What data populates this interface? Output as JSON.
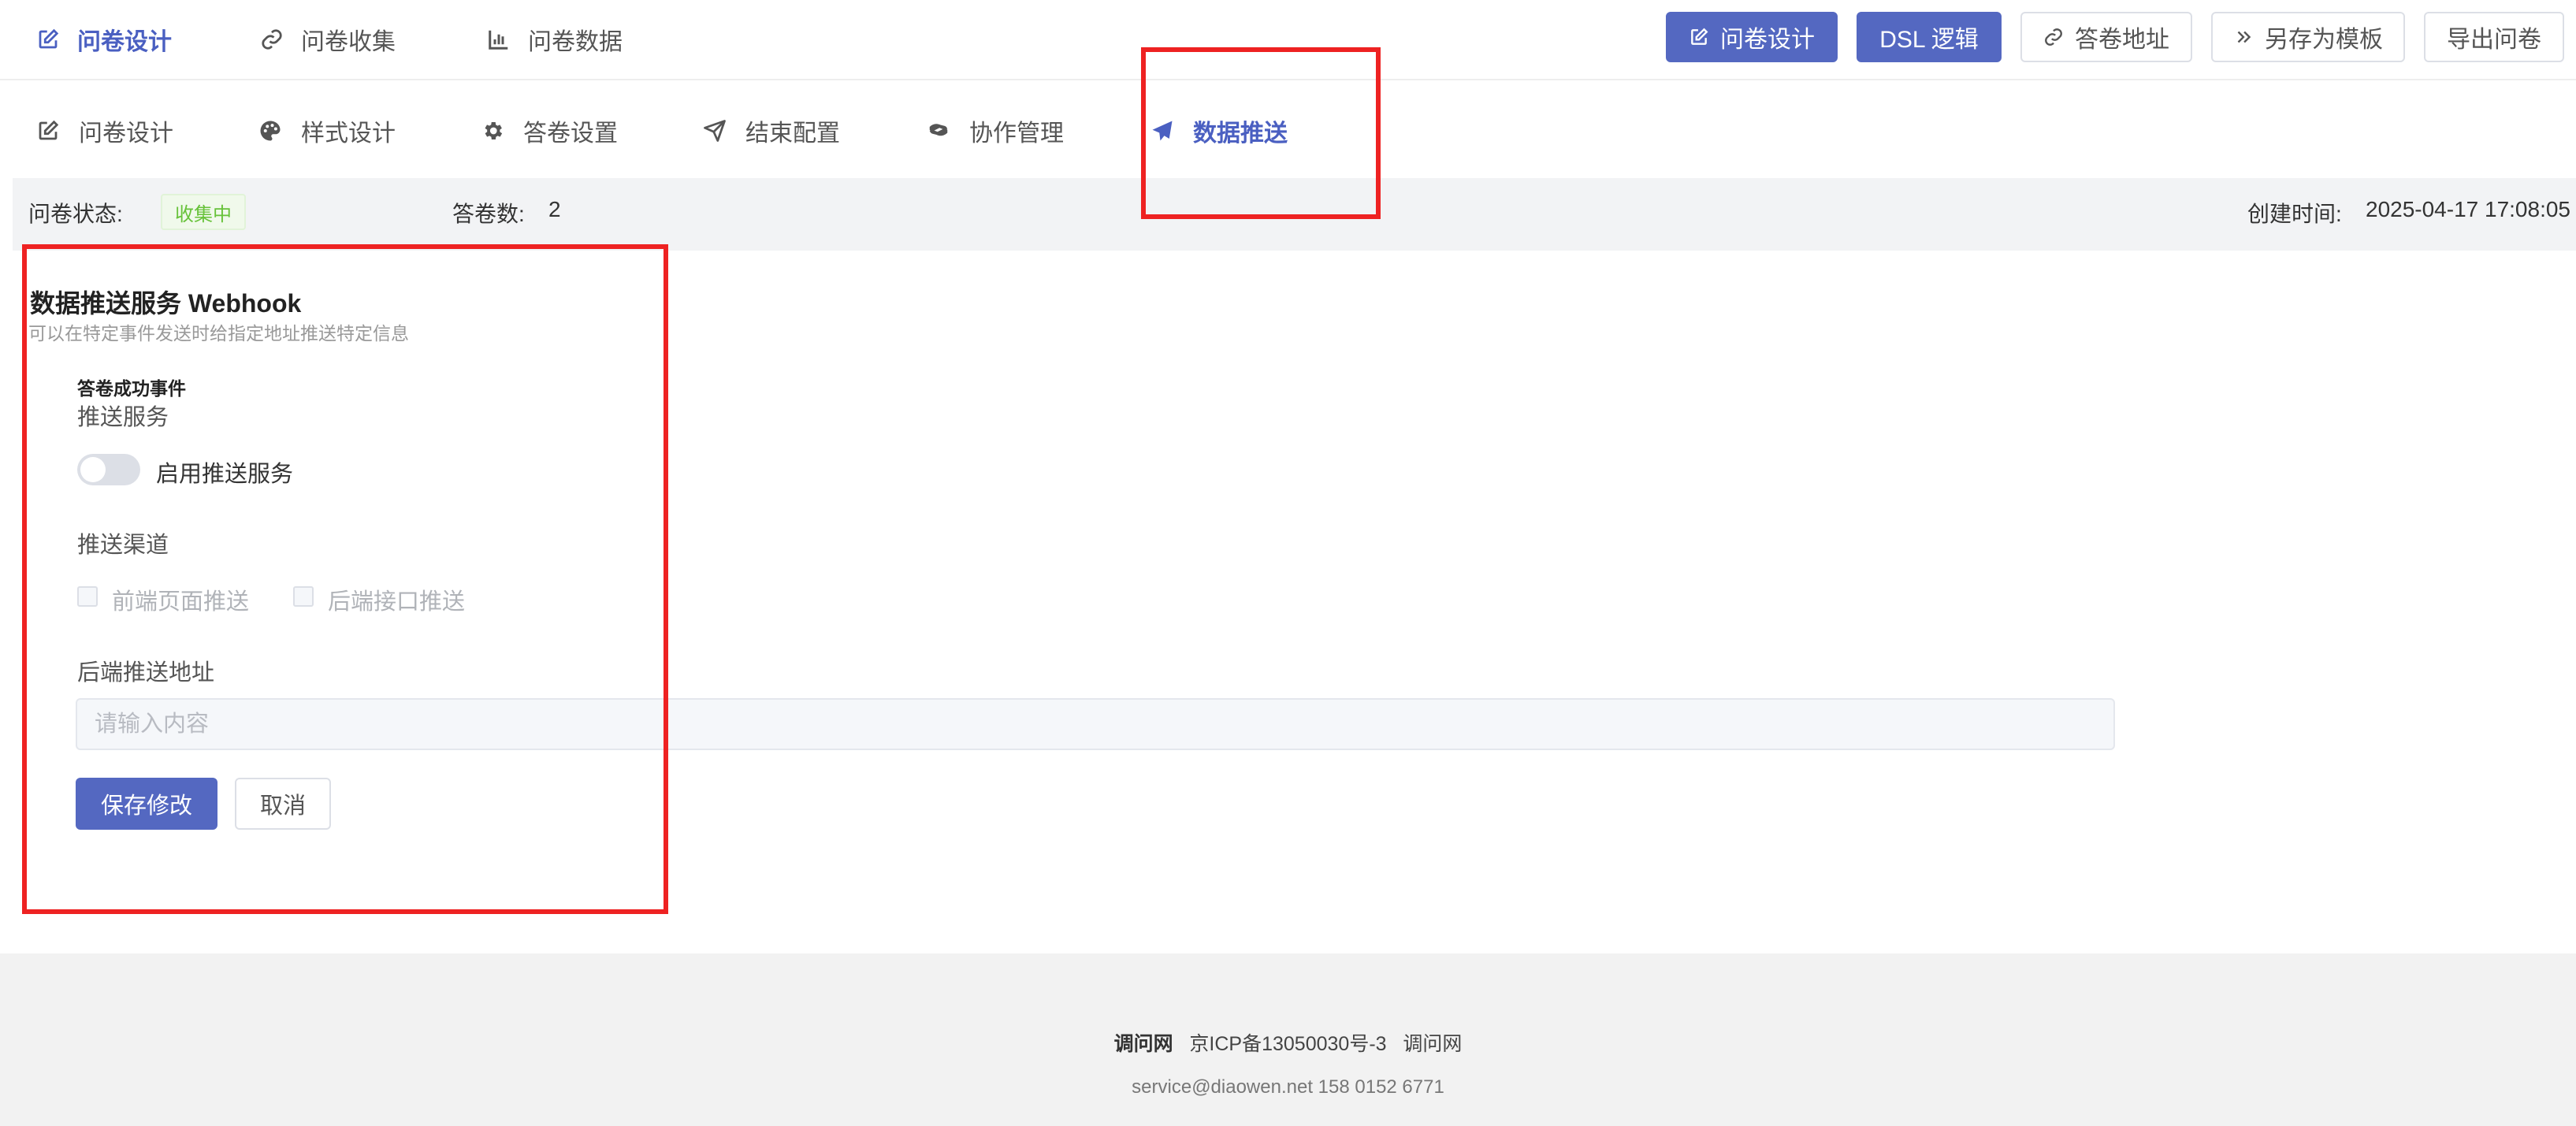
{
  "top_nav": [
    {
      "label": "问卷设计",
      "icon": "edit-icon",
      "active": true
    },
    {
      "label": "问卷收集",
      "icon": "link-icon",
      "active": false
    },
    {
      "label": "问卷数据",
      "icon": "bar-chart-icon",
      "active": false
    }
  ],
  "top_buttons": {
    "design": "问卷设计",
    "dsl": "DSL 逻辑",
    "answer_url": "答卷地址",
    "save_template": "另存为模板",
    "export": "导出问卷"
  },
  "sub_tabs": [
    {
      "label": "问卷设计",
      "icon": "edit-icon"
    },
    {
      "label": "样式设计",
      "icon": "palette-icon"
    },
    {
      "label": "答卷设置",
      "icon": "gear-icon"
    },
    {
      "label": "结束配置",
      "icon": "send-icon"
    },
    {
      "label": "协作管理",
      "icon": "handshake-icon"
    },
    {
      "label": "数据推送",
      "icon": "paper-plane-icon",
      "active": true
    }
  ],
  "status": {
    "label": "问卷状态:",
    "badge": "收集中",
    "count_label": "答卷数:",
    "count_value": "2",
    "created_label": "创建时间:",
    "created_value": "2025-04-17 17:08:05"
  },
  "webhook": {
    "title": "数据推送服务 Webhook",
    "subtitle": "可以在特定事件发送时给指定地址推送特定信息",
    "event_title": "答卷成功事件",
    "service_label": "推送服务",
    "switch_label": "启用推送服务",
    "switch_on": false,
    "channel_label": "推送渠道",
    "channels": [
      "前端页面推送",
      "后端接口推送"
    ],
    "backend_url_label": "后端推送地址",
    "backend_url_placeholder": "请输入内容",
    "backend_url_value": "",
    "save_button": "保存修改",
    "cancel_button": "取消"
  },
  "footer": {
    "brand": "调问网",
    "icp": "京ICP备13050030号-3",
    "brand2": "调问网",
    "contact": "service@diaowen.net 158 0152 6771"
  },
  "colors": {
    "primary": "#5468c1",
    "annotation": "#ee2222",
    "badge_green": "#67c23a"
  }
}
